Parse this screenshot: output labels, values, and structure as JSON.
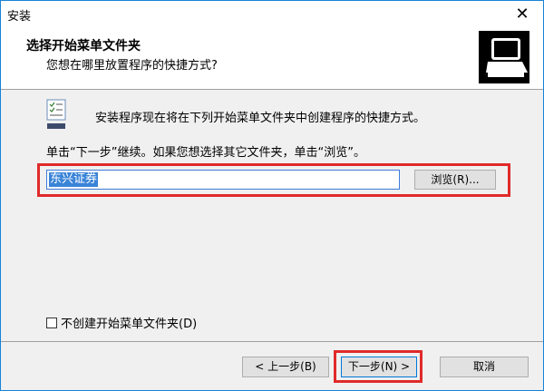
{
  "window": {
    "title": "安装",
    "close_glyph": "✕"
  },
  "header": {
    "title": "选择开始菜单文件夹",
    "subtitle": "您想在哪里放置程序的快捷方式?"
  },
  "content": {
    "intro": "安装程序现在将在下列开始菜单文件夹中创建程序的快捷方式。",
    "hint": "单击“下一步”继续。如果您想选择其它文件夹，单击“浏览”。",
    "folder_value": "东兴证券",
    "browse_label": "浏览(R)...",
    "no_folder_label": "不创建开始菜单文件夹(D)",
    "no_folder_checked": false
  },
  "buttons": {
    "back": "< 上一步(B)",
    "next": "下一步(N) >",
    "cancel": "取消"
  },
  "colors": {
    "highlight_box": "#e02a2a",
    "selection": "#3a84d8",
    "window_border": "#1883d7"
  },
  "icons": [
    "close-icon",
    "setup-wizard-icon",
    "document-list-icon",
    "checkbox-icon"
  ]
}
